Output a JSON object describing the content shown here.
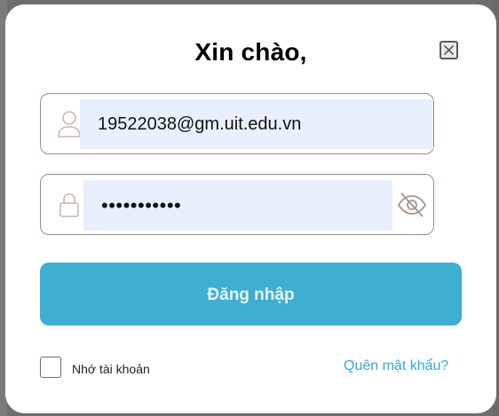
{
  "modal": {
    "title": "Xin chào,",
    "close_icon": "close-icon"
  },
  "form": {
    "email": {
      "icon": "user-icon",
      "value": "19522038@gm.uit.edu.vn"
    },
    "password": {
      "icon": "lock-icon",
      "value": "•••••••••••",
      "toggle_icon": "eye-off-icon"
    },
    "submit_label": "Đăng nhập",
    "remember_label": "Nhớ tài khoản",
    "remember_checked": false,
    "forgot_label": "Quên mật khẩu?"
  },
  "colors": {
    "primary": "#3eaed1",
    "link": "#3aa8cf",
    "field_border": "#a08a80",
    "autofill_bg": "#e8f0fe"
  }
}
